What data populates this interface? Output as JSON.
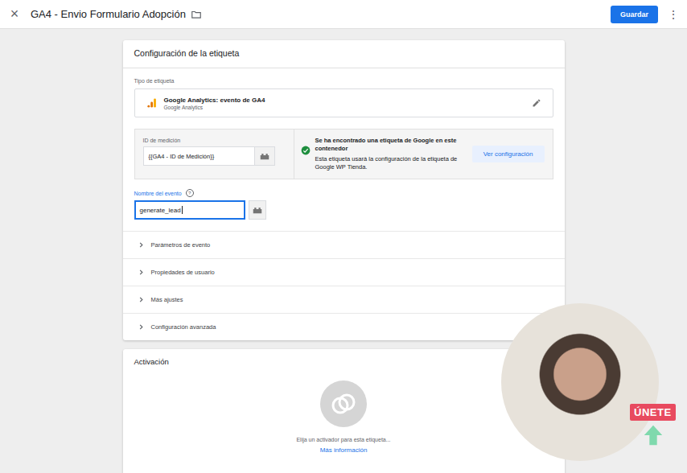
{
  "window": {
    "title": "GA4 - Envio Formulario Adopción",
    "close": "×"
  },
  "toolbar": {
    "save_button": "Guardar",
    "menu": "⋮"
  },
  "tag_config": {
    "heading": "Configuración de la etiqueta",
    "tag_type_label": "Tipo de etiqueta",
    "tag_type": {
      "name": "Google Analytics: evento de GA4",
      "vendor": "Google Analytics"
    },
    "measurement_id": {
      "label": "ID de medición",
      "value": "{{GA4 - ID de Medición}}"
    },
    "notice": {
      "title": "Se ha encontrado una etiqueta de Google en este contenedor",
      "body": "Esta etiqueta usará la configuración de la etiqueta de Google WP Tienda.",
      "button": "Ver configuración"
    },
    "event_name": {
      "label": "Nombre del evento",
      "help": "?",
      "value": "generate_lead",
      "focused": true
    },
    "sections": [
      {
        "label": "Parámetros de evento",
        "expanded": false
      },
      {
        "label": "Propiedades de usuario",
        "expanded": false
      },
      {
        "label": "Más ajustes",
        "expanded": false
      },
      {
        "label": "Configuración avanzada",
        "expanded": false
      }
    ]
  },
  "triggering": {
    "heading": "Activación",
    "empty_text": "Elija un activador para esta etiqueta...",
    "link": "Más información"
  },
  "overlay": {
    "badge": "ÚNETE"
  }
}
